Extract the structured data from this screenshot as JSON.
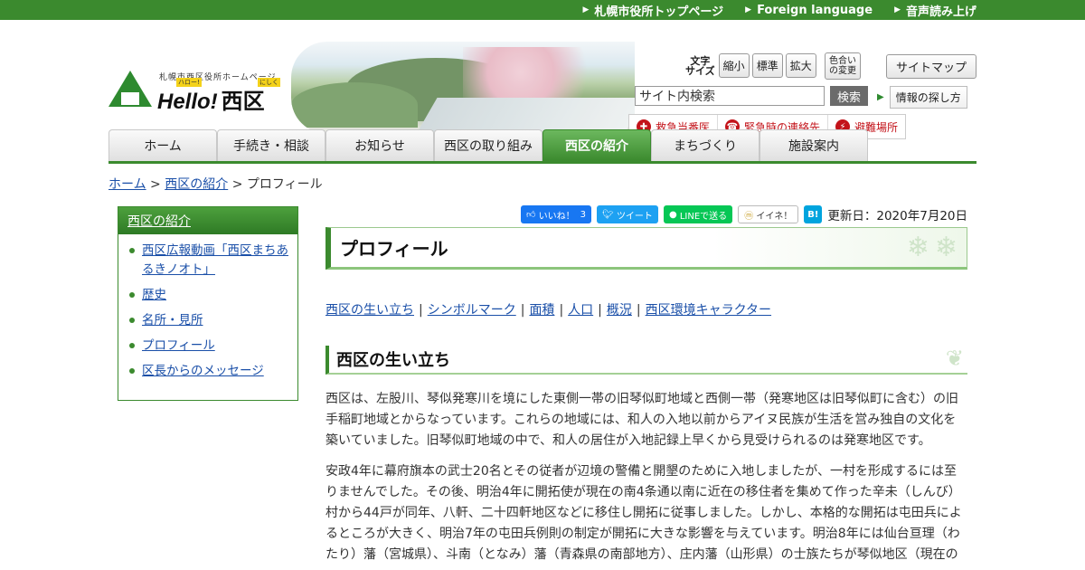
{
  "topbar": {
    "links": [
      "札幌市役所トップページ",
      "Foreign language",
      "音声読み上げ"
    ]
  },
  "logo": {
    "tagline": "札幌市西区役所ホームページ",
    "hello": "Hello!",
    "ward": "西区",
    "ruby_hello": "ハロー!",
    "ruby_ward": "にしく"
  },
  "tools": {
    "font_size_label": "文字サイズ",
    "font_small": "縮小",
    "font_standard": "標準",
    "font_large": "拡大",
    "color_change": "色合いの変更",
    "sitemap": "サイトマップ",
    "search_value": "サイト内検索",
    "search_button": "検索",
    "info_find": "情報の探し方"
  },
  "emergency": [
    {
      "icon": "ambulance-icon",
      "glyph": "✚",
      "label": "救急当番医"
    },
    {
      "icon": "phone-icon",
      "glyph": "☎",
      "label": "緊急時の連絡先"
    },
    {
      "icon": "lightning-icon",
      "glyph": "⚡",
      "label": "避難場所"
    }
  ],
  "nav": {
    "tabs": [
      "ホーム",
      "手続き・相談",
      "お知らせ",
      "西区の取り組み",
      "西区の紹介",
      "まちづくり",
      "施設案内"
    ],
    "active_index": 4
  },
  "breadcrumb": {
    "home": "ホーム",
    "section": "西区の紹介",
    "current": "プロフィール",
    "sep": ">"
  },
  "sidebar": {
    "heading": "西区の紹介",
    "items": [
      "西区広報動画「西区まちあるきノオト」",
      "歴史",
      "名所・見所",
      "プロフィール",
      "区長からのメッセージ"
    ]
  },
  "social": {
    "fb_label": "いいね！",
    "fb_count": "3",
    "tweet": "ツイート",
    "line": "LINEで送る",
    "mixi": "イイネ！",
    "hatena": "B!"
  },
  "updated": "更新日：2020年7月20日",
  "page_title": "プロフィール",
  "anchors": [
    "西区の生い立ち",
    "シンボルマーク",
    "面積",
    "人口",
    "概況",
    "西区環境キャラクター"
  ],
  "section_title": "西区の生い立ち",
  "paragraphs": [
    "西区は、左股川、琴似発寒川を境にした東側一帯の旧琴似町地域と西側一帯（発寒地区は旧琴似町に含む）の旧手稲町地域とからなっています。これらの地域には、和人の入地以前からアイヌ民族が生活を営み独自の文化を築いていました。旧琴似町地域の中で、和人の居住が入地記録上早くから見受けられるのは発寒地区です。",
    "安政4年に幕府旗本の武士20名とその従者が辺境の警備と開墾のために入地しましたが、一村を形成するには至りませんでした。その後、明治4年に開拓使が現在の南4条通以南に近在の移住者を集めて作った辛未（しんび）村から44戸が同年、八軒、二十四軒地区などに移住し開拓に従事しました。しかし、本格的な開拓は屯田兵によるところが大きく、明治7年の屯田兵例則の制定が開拓に大きな影響を与えています。明治8年には仙台亘理（わたり）藩（宮城県）、斗南（となみ）藩（青森県の南部地方）、庄内藩（山形県）の士族たちが琴似地区（現在の"
  ]
}
